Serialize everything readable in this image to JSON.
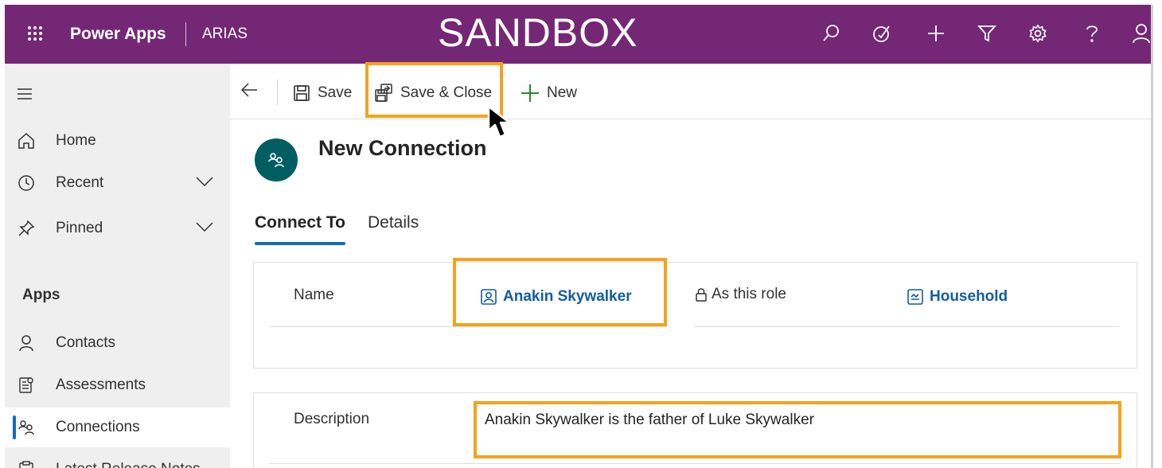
{
  "topbar": {
    "app_name": "Power Apps",
    "env_name": "ARIAS",
    "banner": "SANDBOX",
    "bg_color": "#742774",
    "icons": [
      "search-icon",
      "assistant-icon",
      "plus-icon",
      "filter-icon",
      "settings-icon",
      "help-icon",
      "user-icon"
    ]
  },
  "sidebar": {
    "items": [
      {
        "label": "Home",
        "icon": "home-icon"
      },
      {
        "label": "Recent",
        "icon": "clock-icon"
      },
      {
        "label": "Pinned",
        "icon": "pin-icon"
      }
    ],
    "section_title": "Apps",
    "apps": [
      {
        "label": "Contacts",
        "icon": "person-icon"
      },
      {
        "label": "Assessments",
        "icon": "assessment-icon"
      },
      {
        "label": "Connections",
        "icon": "connections-icon",
        "selected": true
      },
      {
        "label": "Latest Release Notes",
        "icon": "notes-icon"
      }
    ]
  },
  "commandbar": {
    "save_label": "Save",
    "save_close_label": "Save & Close",
    "new_label": "New"
  },
  "form": {
    "title": "New Connection",
    "tabs": [
      {
        "label": "Connect To",
        "active": true
      },
      {
        "label": "Details",
        "active": false
      }
    ],
    "name_label": "Name",
    "name_value": "Anakin Skywalker",
    "role_label": "As this role",
    "role_value": "Household",
    "description_label": "Description",
    "description_value": "Anakin Skywalker is the father of Luke Skywalker"
  },
  "colors": {
    "accent": "#0f6cbd",
    "highlight": "#f5a21b",
    "link": "#115ea3",
    "avatar": "#005e63"
  }
}
